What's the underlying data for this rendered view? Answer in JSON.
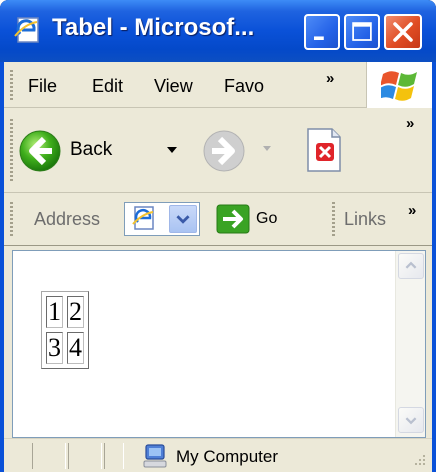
{
  "window": {
    "title": "Tabel - Microsof...",
    "colors": {
      "titlebar": "#0a51d8",
      "close": "#e04d24",
      "chrome": "#ece9d8"
    }
  },
  "menu": {
    "items": [
      "File",
      "Edit",
      "View",
      "Favo"
    ],
    "overflow": "»"
  },
  "toolbar": {
    "back_label": "Back",
    "overflow": "»"
  },
  "address": {
    "label": "Address",
    "go_label": "Go",
    "links_label": "Links",
    "overflow": "»"
  },
  "content": {
    "table": [
      [
        "1",
        "2"
      ],
      [
        "3",
        "4"
      ]
    ]
  },
  "status": {
    "zone_label": "My Computer"
  },
  "icons": {
    "title": "ie-page-icon",
    "minimize": "minimize-icon",
    "maximize": "maximize-icon",
    "close": "close-icon",
    "windows_logo": "windows-logo-icon",
    "back": "back-arrow-icon",
    "forward": "forward-arrow-icon",
    "stop": "stop-page-icon",
    "go": "go-arrow-icon",
    "zone": "my-computer-icon"
  }
}
